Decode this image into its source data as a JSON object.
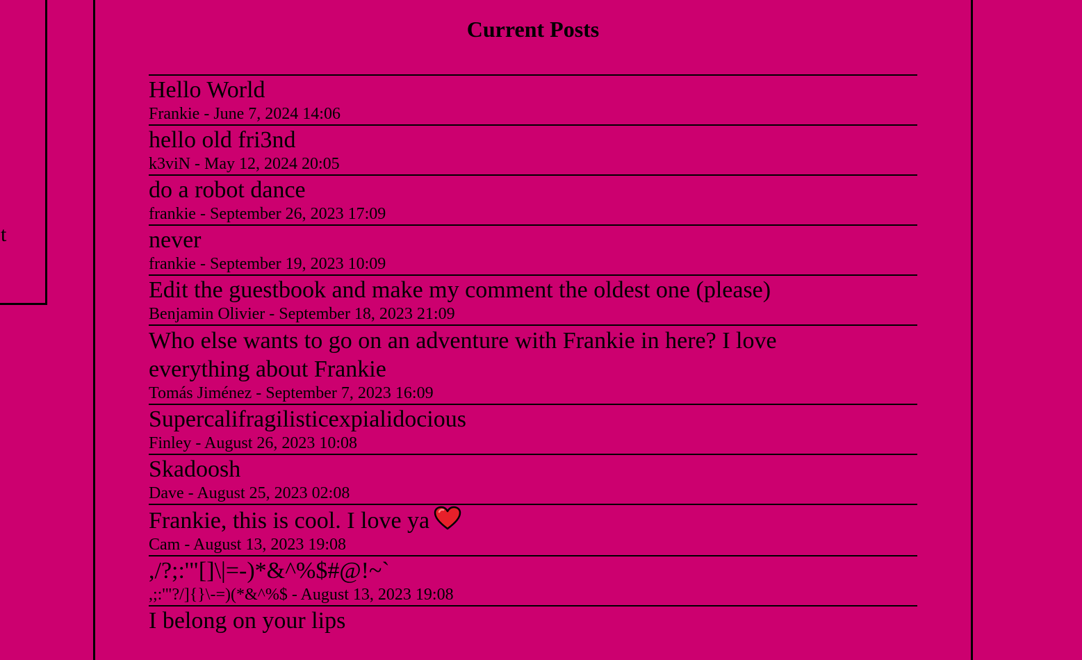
{
  "left_panel": {
    "fragment": "t"
  },
  "page": {
    "title": "Current Posts"
  },
  "posts": [
    {
      "text": "Hello World",
      "author": "Frankie",
      "date": "June 7, 2024 14:06"
    },
    {
      "text": "hello old fri3nd",
      "author": "k3viN",
      "date": "May 12, 2024 20:05"
    },
    {
      "text": "do a robot dance",
      "author": "frankie",
      "date": "September 26, 2023 17:09"
    },
    {
      "text": "never",
      "author": "frankie",
      "date": "September 19, 2023 10:09"
    },
    {
      "text": "Edit the guestbook and make my comment the oldest one (please)",
      "author": "Benjamin Olivier",
      "date": "September 18, 2023 21:09"
    },
    {
      "text": "Who else wants to go on an adventure with Frankie in here? I love everything about Frankie",
      "author": "Tomás Jiménez",
      "date": "September 7, 2023 16:09"
    },
    {
      "text": "Supercalifragilisticexpialidocious",
      "author": "Finley",
      "date": "August 26, 2023 10:08"
    },
    {
      "text": "Skadoosh",
      "author": "Dave",
      "date": "August 25, 2023 02:08"
    },
    {
      "text": "Frankie, this is cool. I love ya",
      "author": "Cam",
      "date": "August 13, 2023 19:08",
      "emoji": "heart-icon"
    },
    {
      "text": ",/?;:'\"[]\\|=-)*&^%$#@!~`",
      "author": ",;:'\"?/]{}\\-=)(*&^%$",
      "date": "August 13, 2023 19:08"
    },
    {
      "text": "I belong on your lips",
      "author": "",
      "date": ""
    }
  ],
  "colors": {
    "background": "#cc006f",
    "border": "#000000",
    "heart": "#e8202a"
  }
}
